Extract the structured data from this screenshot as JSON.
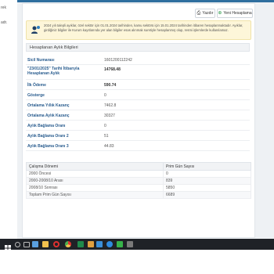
{
  "sidebar": {
    "items": [
      "rek",
      "adr."
    ]
  },
  "toolbar": {
    "print_label": "Yazdır",
    "new_label": "Yeni Hesaplama"
  },
  "alert": {
    "text": "2024 yılı talepli ayıklar, özel sektör için 01.01.2024 tarihinden, kamu sektörü için 15.01.2024 tarihinden itibaren hesaplanmaktadır. Ayıklar, girdiğiniz bilgiler ile Kurum kayıtlarında yer alan bilgiler esas alınmak suretiyle hesaplanmış olup, resmi işlemlerde kullanılamaz."
  },
  "details": {
    "title": "Hesaplanan Aylık Bilgileri",
    "rows": [
      {
        "label": "Sicil Numarası",
        "value": "1601200112242"
      },
      {
        "label": "\"23/01/2025\" Tarihi İtibarıyla Hesaplanan Aylık",
        "value": "14768.48"
      },
      {
        "label": "İlk Ödeme",
        "value": "590.74"
      },
      {
        "label": "Gösterge",
        "value": "0"
      },
      {
        "label": "Ortalama Yıllık Kazanç",
        "value": "7462.8"
      },
      {
        "label": "Ortalama Aylık Kazanç",
        "value": "30327"
      },
      {
        "label": "Aylık Bağlama Oranı",
        "value": "0"
      },
      {
        "label": "Aylık Bağlama Oranı 2",
        "value": "51"
      },
      {
        "label": "Aylık Bağlama Oranı 3",
        "value": "44.83"
      }
    ]
  },
  "table": {
    "headers": [
      "Çalışma Dönemi",
      "Prim Gün Sayısı"
    ],
    "rows": [
      [
        "2000 Öncesi",
        "0"
      ],
      [
        "2000-2008/10 Arası",
        "839"
      ],
      [
        "2008/10 Sonrası",
        "5850"
      ],
      [
        "Toplam Prim Gün Sayısı",
        "6689"
      ]
    ]
  },
  "taskbar": {
    "icons": [
      {
        "name": "windows-icon",
        "color": "#ffffff"
      },
      {
        "name": "search-icon",
        "color": "#d0d0d0"
      },
      {
        "name": "task-view-icon",
        "color": "#d0d0d0"
      },
      {
        "name": "image-viewer-icon",
        "color": "#5aa0e0"
      },
      {
        "name": "file-explorer-icon",
        "color": "#f2c14e"
      },
      {
        "name": "opera-icon",
        "color": "#e0302f"
      },
      {
        "name": "chrome-icon",
        "color": "#4caf50"
      },
      {
        "name": "excel-icon",
        "color": "#1f8a4c"
      },
      {
        "name": "app-icon",
        "color": "#e0a040"
      },
      {
        "name": "store-icon",
        "color": "#3b8fd9"
      },
      {
        "name": "cloud-icon",
        "color": "#2f8be0"
      },
      {
        "name": "green-app-icon",
        "color": "#37b34a"
      },
      {
        "name": "app-icon-2",
        "color": "#7a7a7a"
      }
    ]
  }
}
